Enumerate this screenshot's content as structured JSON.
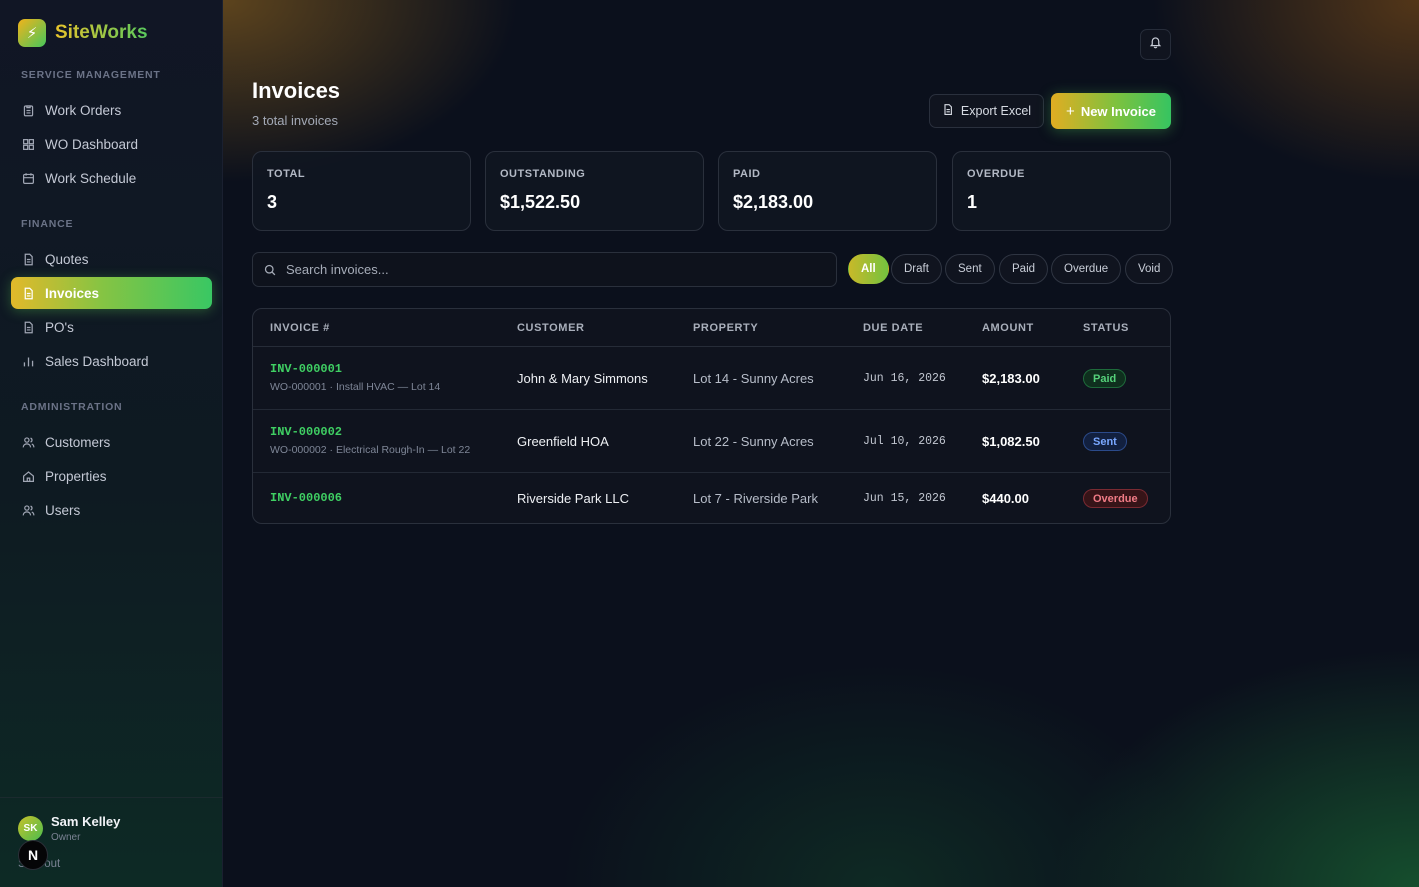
{
  "brand": {
    "name": "SiteWorks",
    "logo_icon": "bolt-icon"
  },
  "sidebar": {
    "sections": [
      {
        "label": "SERVICE MANAGEMENT",
        "items": [
          {
            "label": "Work Orders",
            "icon": "clipboard-icon"
          },
          {
            "label": "WO Dashboard",
            "icon": "grid-icon"
          },
          {
            "label": "Work Schedule",
            "icon": "calendar-icon"
          }
        ]
      },
      {
        "label": "FINANCE",
        "items": [
          {
            "label": "Quotes",
            "icon": "document-icon"
          },
          {
            "label": "Invoices",
            "icon": "document-icon",
            "active": true
          },
          {
            "label": "PO's",
            "icon": "document-icon"
          },
          {
            "label": "Sales Dashboard",
            "icon": "bar-chart-icon"
          }
        ]
      },
      {
        "label": "ADMINISTRATION",
        "items": [
          {
            "label": "Customers",
            "icon": "users-icon"
          },
          {
            "label": "Properties",
            "icon": "home-icon"
          },
          {
            "label": "Users",
            "icon": "users-icon"
          }
        ]
      }
    ]
  },
  "user": {
    "initials": "SK",
    "name": "Sam Kelley",
    "role": "Owner",
    "signout": "Sign out",
    "badge": "N"
  },
  "header": {
    "title": "Invoices",
    "subtitle": "3 total invoices",
    "export_label": "Export Excel",
    "new_label": "New Invoice"
  },
  "stats": [
    {
      "label": "TOTAL",
      "value": "3"
    },
    {
      "label": "OUTSTANDING",
      "value": "$1,522.50"
    },
    {
      "label": "PAID",
      "value": "$2,183.00"
    },
    {
      "label": "OVERDUE",
      "value": "1"
    }
  ],
  "search": {
    "placeholder": "Search invoices..."
  },
  "filters": [
    "All",
    "Draft",
    "Sent",
    "Paid",
    "Overdue",
    "Void"
  ],
  "active_filter": "All",
  "table": {
    "columns": [
      "INVOICE #",
      "CUSTOMER",
      "PROPERTY",
      "DUE DATE",
      "AMOUNT",
      "STATUS"
    ],
    "rows": [
      {
        "invoice": "INV-000001",
        "work_order": "WO-000001 · Install HVAC — Lot 14",
        "customer": "John & Mary Simmons",
        "property": "Lot 14 - Sunny Acres",
        "due": "Jun 16, 2026",
        "amount": "$2,183.00",
        "status": "Paid"
      },
      {
        "invoice": "INV-000002",
        "work_order": "WO-000002 · Electrical Rough-In — Lot 22",
        "customer": "Greenfield HOA",
        "property": "Lot 22 - Sunny Acres",
        "due": "Jul 10, 2026",
        "amount": "$1,082.50",
        "status": "Sent"
      },
      {
        "invoice": "INV-000006",
        "work_order": "",
        "customer": "Riverside Park LLC",
        "property": "Lot 7 - Riverside Park",
        "due": "Jun 15, 2026",
        "amount": "$440.00",
        "status": "Overdue"
      }
    ]
  },
  "colors": {
    "accent_gold": "#e1ad22",
    "accent_green": "#36c461",
    "paid": "#55d17a",
    "sent": "#79a7ff",
    "overdue": "#f07b86"
  }
}
